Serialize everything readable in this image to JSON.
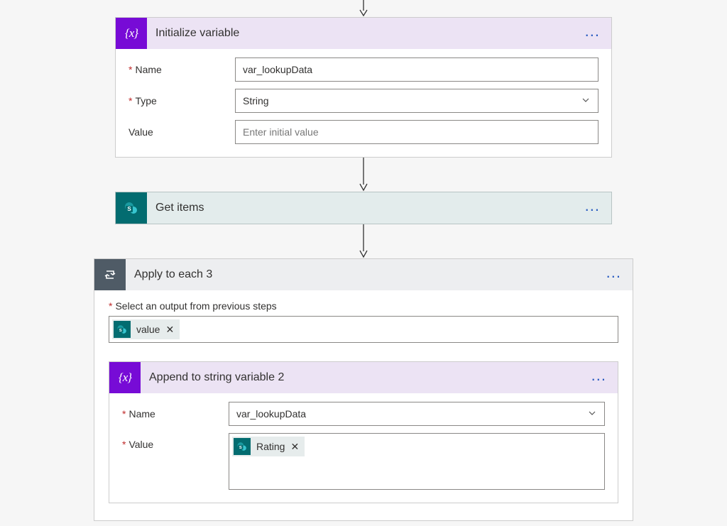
{
  "initVar": {
    "title": "Initialize variable",
    "nameLabel": "Name",
    "nameValue": "var_lookupData",
    "typeLabel": "Type",
    "typeValue": "String",
    "valueLabel": "Value",
    "valuePlaceholder": "Enter initial value"
  },
  "getItems": {
    "title": "Get items"
  },
  "applyEach": {
    "title": "Apply to each 3",
    "selectLabel": "Select an output from previous steps",
    "tokenValue": "value"
  },
  "appendVar": {
    "title": "Append to string variable 2",
    "nameLabel": "Name",
    "nameValue": "var_lookupData",
    "valueLabel": "Value",
    "tokenRating": "Rating"
  }
}
